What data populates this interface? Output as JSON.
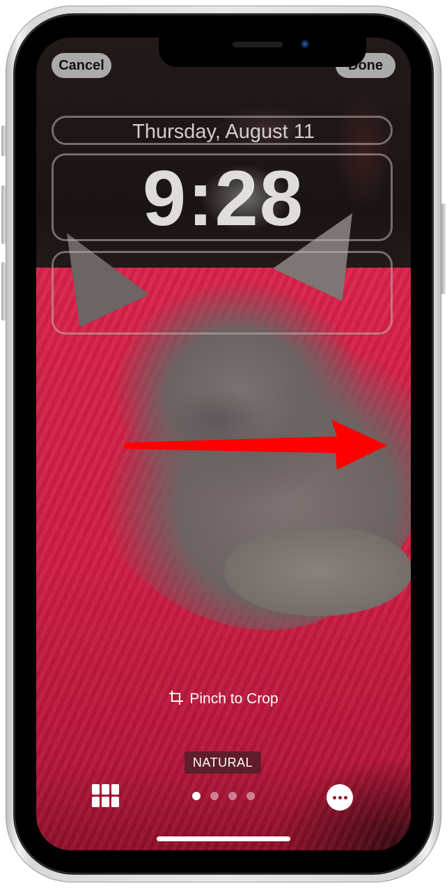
{
  "device": "iPhone lock screen customization",
  "top_bar": {
    "cancel_label": "Cancel",
    "done_label": "Done"
  },
  "lock_screen": {
    "date": "Thursday, August 11",
    "time": "9:28"
  },
  "hint": {
    "icon": "crop-icon",
    "text": "Pinch to Crop"
  },
  "photo_style": {
    "label": "NATURAL"
  },
  "bottom_bar": {
    "left_icon": "grid-icon",
    "right_icon": "ellipsis-icon",
    "page_count": 4,
    "active_page": 1
  },
  "annotation": {
    "type": "arrow",
    "direction": "right",
    "color": "#ff0000"
  },
  "colors": {
    "pill_button_bg": "#bebebe",
    "blanket_red": "#d9234a",
    "widget_outline": "#beb4b2",
    "style_label_bg": "#501e28"
  }
}
